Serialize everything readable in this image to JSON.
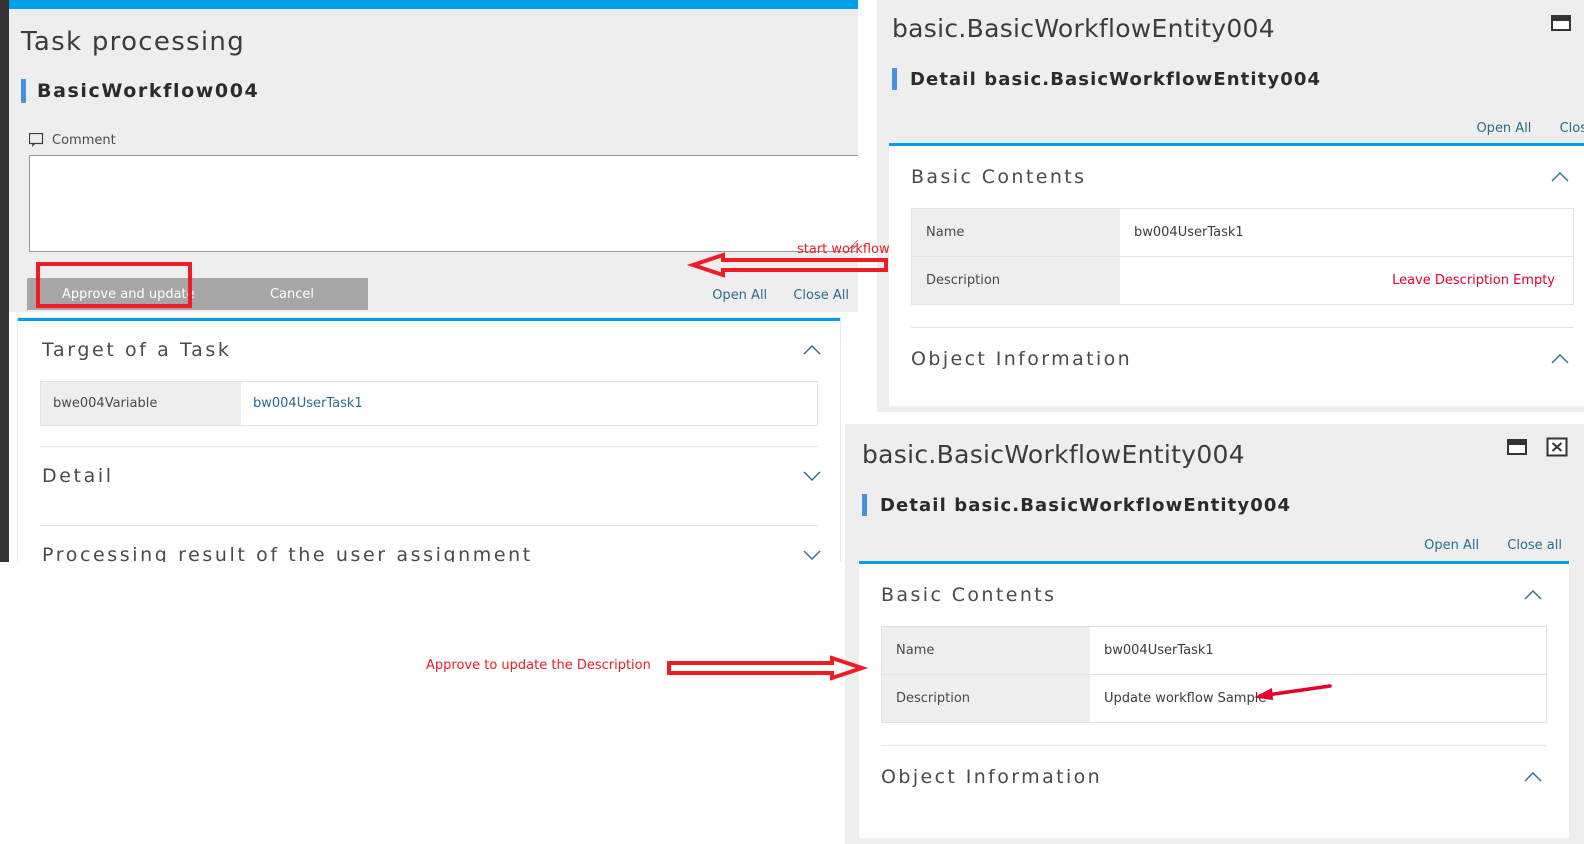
{
  "colors": {
    "accent_blue": "#00a0e9",
    "link_blue": "#2b6c8f",
    "annotation_red": "#ee1c25",
    "warn_red": "#e4002b",
    "button_gray": "#a6a6a6",
    "panel_gray": "#eeeeee",
    "rail_dark": "#333333"
  },
  "task_panel": {
    "page_title": "Task processing",
    "workflow_name": "BasicWorkflow004",
    "comment_icon": "speech-bubble-icon",
    "comment_label": "Comment",
    "comment_value": "",
    "comment_placeholder": "",
    "buttons": {
      "approve_label": "Approve and update",
      "cancel_label": "Cancel"
    },
    "links": {
      "open_all": "Open All",
      "close_all": "Close All"
    },
    "sections": [
      {
        "title": "Target of a Task",
        "expanded": true,
        "chevron": "chevron-up-icon",
        "rows": [
          {
            "key": "bwe004Variable",
            "value": "bw004UserTask1"
          }
        ]
      },
      {
        "title": "Detail",
        "expanded": false,
        "chevron": "chevron-down-icon",
        "rows": []
      },
      {
        "title": "Processing result of the user assignment",
        "expanded": false,
        "chevron": "chevron-down-icon",
        "rows": []
      }
    ]
  },
  "detail_dialog_top": {
    "title": "basic.BasicWorkflowEntity004",
    "subtitle": "Detail basic.BasicWorkflowEntity004",
    "window_buttons": [
      {
        "icon": "restore-window-icon",
        "label": "Restore"
      }
    ],
    "links": {
      "open_all": "Open All",
      "close_all": "Clos"
    },
    "sections": [
      {
        "title": "Basic Contents",
        "expanded": true,
        "chevron": "chevron-up-icon",
        "rows": [
          {
            "key": "Name",
            "value": "bw004UserTask1",
            "note": ""
          },
          {
            "key": "Description",
            "value": "",
            "note": "Leave Description Empty"
          }
        ]
      },
      {
        "title": "Object Information",
        "expanded": true,
        "chevron": "chevron-up-icon",
        "rows": []
      }
    ]
  },
  "detail_dialog_bottom": {
    "title": "basic.BasicWorkflowEntity004",
    "subtitle": "Detail basic.BasicWorkflowEntity004",
    "window_buttons": [
      {
        "icon": "restore-window-icon",
        "label": "Restore"
      },
      {
        "icon": "close-window-icon",
        "label": "Close"
      }
    ],
    "links": {
      "open_all": "Open All",
      "close_all": "Close all"
    },
    "sections": [
      {
        "title": "Basic Contents",
        "expanded": true,
        "chevron": "chevron-up-icon",
        "rows": [
          {
            "key": "Name",
            "value": "bw004UserTask1",
            "note": ""
          },
          {
            "key": "Description",
            "value": "Update workflow Sample",
            "note": ""
          }
        ]
      },
      {
        "title": "Object Information",
        "expanded": true,
        "chevron": "chevron-up-icon",
        "rows": []
      }
    ]
  },
  "annotations": [
    {
      "id": "start-workflow",
      "text": "start workflow",
      "arrow": "block-arrow-left-icon",
      "color": "#ee1c25"
    },
    {
      "id": "approve-to-update",
      "text": "Approve to update the Description",
      "arrow": "block-arrow-right-icon",
      "color": "#ee1c25"
    },
    {
      "id": "description-pointer",
      "text": "",
      "arrow": "thin-arrow-left-icon",
      "color": "#e4002b"
    },
    {
      "id": "approve-button-highlight",
      "text": "",
      "arrow": "red-rectangle-highlight",
      "color": "#ee1c25"
    }
  ]
}
